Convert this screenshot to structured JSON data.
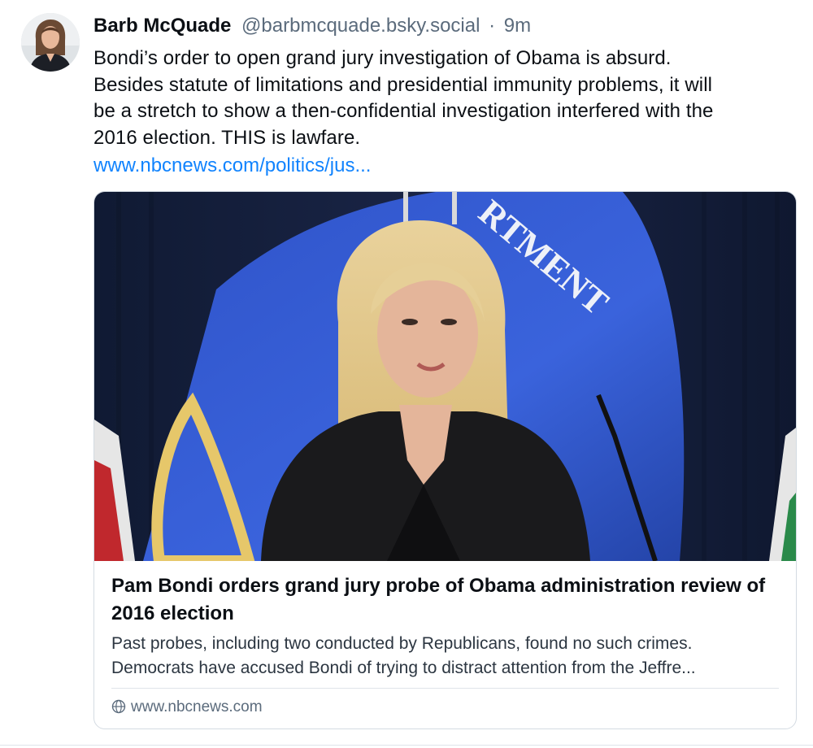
{
  "post": {
    "author_name": "Barb McQuade",
    "author_handle": "@barbmcquade.bsky.social",
    "separator": "·",
    "time": "9m",
    "text_lines": [
      "Bondi’s order to open grand jury investigation of Obama is absurd.",
      "Besides statute of limitations and presidential immunity problems, it will",
      "be a stretch to show a then-confidential investigation interfered with the",
      "2016 election. THIS is lawfare."
    ],
    "link_text": "www.nbcnews.com/politics/jus...",
    "avatar_icon": "avatar-photo"
  },
  "card": {
    "image_icon": "article-photo",
    "title": "Pam Bondi orders grand jury probe of Obama administration review of 2016 election",
    "description_lines": [
      "Past probes, including two conducted by Republicans, found no such crimes.",
      "Democrats have accused Bondi of trying to distract attention from the Jeffre..."
    ],
    "domain": "www.nbcnews.com",
    "domain_icon": "globe-icon"
  },
  "colors": {
    "link": "#1083fe",
    "muted": "#5b6b7c",
    "text": "#0b0f14",
    "border": "#d4dbe2"
  }
}
